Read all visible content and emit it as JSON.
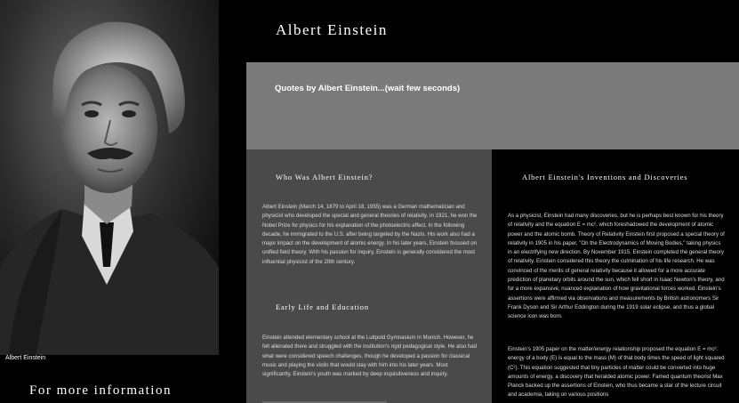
{
  "sidebar": {
    "portrait_alt": "Albert Einstein portrait",
    "caption": "Albert Einstein",
    "more_info": "For more information"
  },
  "header": {
    "title": "Albert Einstein"
  },
  "quote_band": {
    "text": "Quotes by Albert Einstein...(wait few seconds)"
  },
  "sections": {
    "who": {
      "heading": "Who Was Albert Einstein?",
      "body": "Albert Einstein (March 14, 1879 to April 18, 1955) was a German mathematician and physicist who developed the special and general theories of relativity. In 1921, he won the Nobel Prize for physics for his explanation of the photoelectric effect. In the following decade, he immigrated to the U.S. after being targeted by the Nazis. His work also had a major impact on the development of atomic energy. In his later years, Einstein focused on unified field theory. With his passion for inquiry, Einstein is generally considered the most influential physicist of the 20th century."
    },
    "early": {
      "heading": "Early Life and Education",
      "body": "Einstein attended elementary school at the Luitpold Gymnasium in Munich. However, he felt alienated there and struggled with the institution's rigid pedagogical style. He also had what were considered speech challenges, though he developed a passion for classical music and playing the violin that would stay with him into his later years. Most significantly, Einstein's youth was marked by deep inquisitiveness and inquiry."
    },
    "inventions": {
      "heading": "Albert Einstein's Inventions and Discoveries",
      "body1": "As a physicist, Einstein had many discoveries, but he is perhaps best known for his theory of relativity and the equation E = mc², which foreshadowed the development of atomic power and the atomic bomb. Theory of Relativity Einstein first proposed a special theory of relativity in 1905 in his paper, \"On the Electrodynamics of Moving Bodies,\" taking physics in an electrifying new direction. By November 1915, Einstein completed the general theory of relativity. Einstein considered this theory the culmination of his life research. He was convinced of the merits of general relativity because it allowed for a more accurate prediction of planetary orbits around the sun, which fell short in Isaac Newton's theory, and for a more expansive, nuanced explanation of how gravitational forces worked. Einstein's assertions were affirmed via observations and measurements by British astronomers Sir Frank Dyson and Sir Arthur Eddington during the 1919 solar eclipse, and thus a global science icon was born.",
      "body2": "Einstein's 1905 paper on the matter/energy relationship proposed the equation E = mc²: energy of a body (E) is equal to the mass (M) of that body times the speed of light squared (C²). This equation suggested that tiny particles of matter could be converted into huge amounts of energy, a discovery that heralded atomic power. Famed quantum theorist Max Planck backed up the assertions of Einstein, who thus became a star of the lecture circuit and academia, taking on various positions"
    }
  }
}
